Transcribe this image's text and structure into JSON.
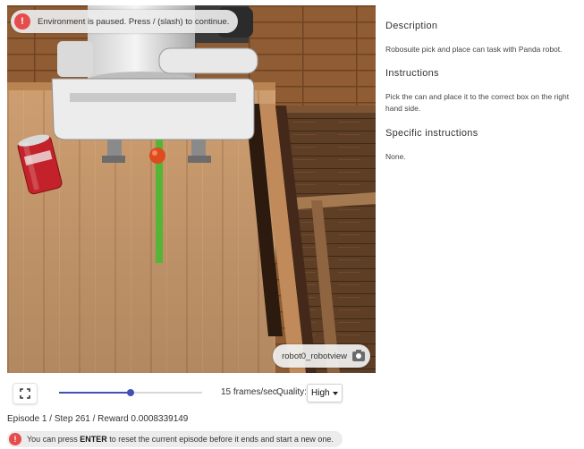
{
  "viewport": {
    "pause_message": "Environment is paused. Press / (slash) to continue.",
    "camera_label": "robot0_robotview",
    "icons": {
      "pause_alert": "exclamation-icon",
      "camera": "camera-icon"
    }
  },
  "controls": {
    "fullscreen_icon": "fullscreen-icon",
    "speed_fraction": 0.5,
    "fps_text": "15 frames/sec",
    "quality_label": "Quality:",
    "quality_value": "High"
  },
  "status": {
    "episode_text": "Episode 1 / Step 261 / Reward 0.0008339149",
    "enter_prefix": "You can press ",
    "enter_key": "ENTER",
    "enter_suffix": " to reset the current episode before it ends and start a new one."
  },
  "side_panel": {
    "description_title": "Description",
    "description_text": "Robosuite pick and place can task with Panda robot.",
    "instructions_title": "Instructions",
    "instructions_text": "Pick the can and place it to the correct box on the right hand side.",
    "specific_title": "Specific instructions",
    "specific_text": "None."
  },
  "colors": {
    "accent": "#3f51b5",
    "alert": "#e74c4c",
    "table_wood": "#d9a878",
    "floor_wood": "#8a5a32",
    "bin_wood": "#5a3b22",
    "can_red": "#c4222a",
    "gripper_green": "#55b536"
  }
}
